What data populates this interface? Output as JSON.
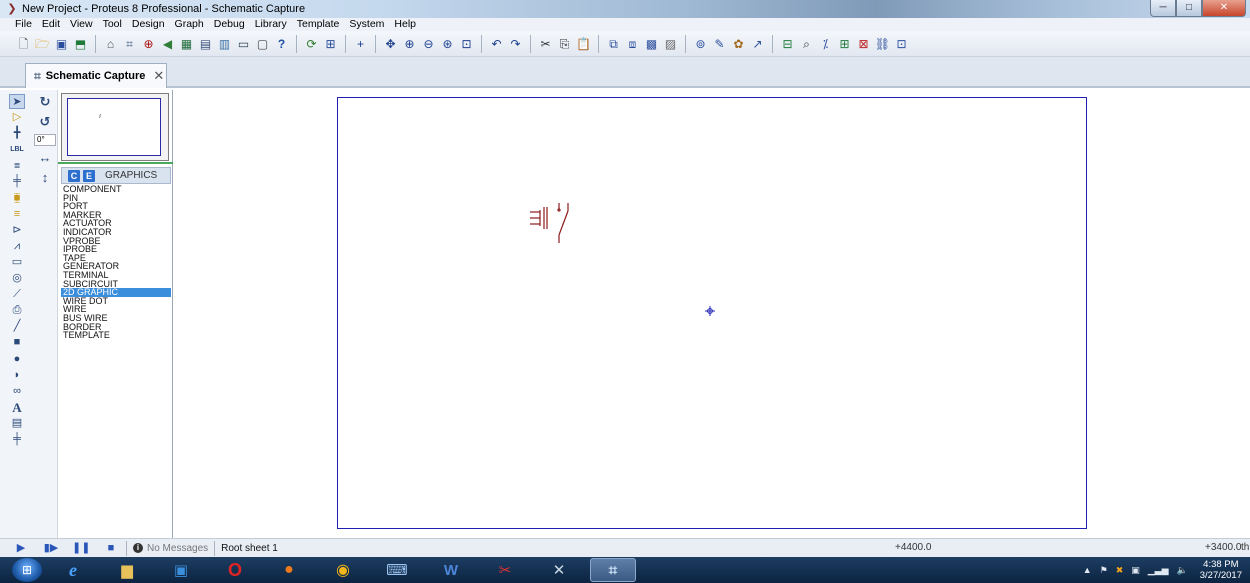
{
  "window": {
    "title": "New Project - Proteus 8 Professional - Schematic Capture",
    "buttons": {
      "minimize": "─",
      "maximize": "□",
      "close": "✕"
    }
  },
  "menu": [
    "File",
    "Edit",
    "View",
    "Tool",
    "Design",
    "Graph",
    "Debug",
    "Library",
    "Template",
    "System",
    "Help"
  ],
  "tab": {
    "label": "Schematic Capture",
    "close": "✕"
  },
  "angle_field": {
    "value": "0°"
  },
  "object_selector": {
    "buttons": [
      "C",
      "E"
    ],
    "title": "GRAPHICS",
    "items": [
      "COMPONENT",
      "PIN",
      "PORT",
      "MARKER",
      "ACTUATOR",
      "INDICATOR",
      "VPROBE",
      "IPROBE",
      "TAPE",
      "GENERATOR",
      "TERMINAL",
      "SUBCIRCUIT",
      "2D GRAPHIC",
      "WIRE DOT",
      "WIRE",
      "BUS WIRE",
      "BORDER",
      "TEMPLATE"
    ],
    "selected": "2D GRAPHIC"
  },
  "status": {
    "messages": "No Messages",
    "sheet": "Root sheet 1",
    "coord_x": "+4400.0",
    "coord_y": "+3400.0",
    "units": "th"
  },
  "taskbar": {
    "clock_time": "4:38 PM",
    "clock_date": "3/27/2017"
  },
  "colors": {
    "sheet_border": "#1f1fb5",
    "component": "#8b1a1a",
    "selection": "#3b8edc"
  }
}
